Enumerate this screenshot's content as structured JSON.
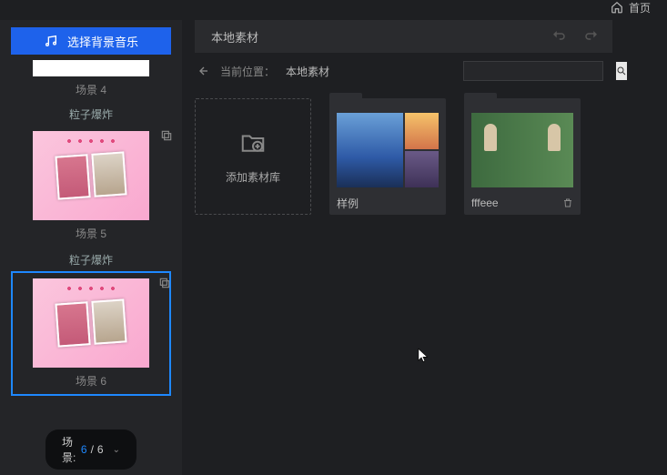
{
  "topbar": {
    "home_label": "首页"
  },
  "sidebar": {
    "music_button": "选择背景音乐",
    "scenes": [
      {
        "label": "场景 4"
      },
      {
        "effect": "粒子爆炸",
        "label": "场景 5"
      },
      {
        "effect": "粒子爆炸",
        "label": "场景 6"
      }
    ],
    "footer": {
      "prefix": "场景:",
      "current": "6",
      "sep": "/",
      "total": "6"
    }
  },
  "content": {
    "tab": "本地素材",
    "path": {
      "crumb_label": "当前位置：",
      "crumb_value": "本地素材"
    },
    "search": {
      "placeholder": ""
    },
    "add_card_label": "添加素材库",
    "folders": [
      {
        "name": "样例"
      },
      {
        "name": "fffeee"
      }
    ]
  }
}
